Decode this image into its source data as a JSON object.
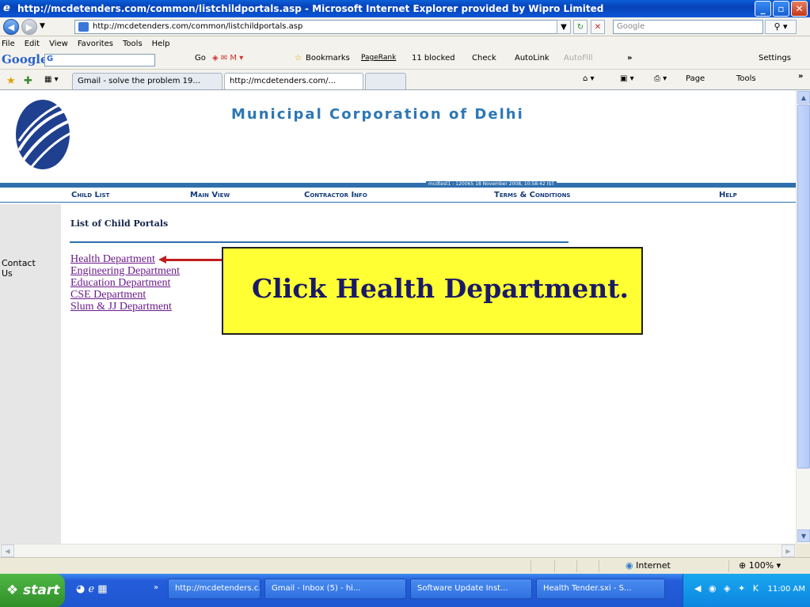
{
  "window": {
    "title": "http://mcdetenders.com/common/listchildportals.asp - Microsoft Internet Explorer provided by Wipro Limited"
  },
  "addressbar": {
    "url": "http://mcdetenders.com/common/listchildportals.asp",
    "search_placeholder": "Google"
  },
  "menubar": {
    "items": [
      "File",
      "Edit",
      "View",
      "Favorites",
      "Tools",
      "Help"
    ]
  },
  "google_toolbar": {
    "logo": "Google",
    "search_value": "G",
    "go": "Go",
    "bookmarks": "Bookmarks",
    "pagerank": "PageRank",
    "blocked": "11 blocked",
    "check": "Check",
    "autolink": "AutoLink",
    "autofill": "AutoFill",
    "more": "»",
    "settings": "Settings"
  },
  "tabs": [
    {
      "label": "Gmail - solve the problem 19..."
    },
    {
      "label": "http://mcdetenders.com/..."
    }
  ],
  "command_bar": {
    "page": "Page",
    "tools": "Tools",
    "more": "»"
  },
  "page": {
    "site_title": "Municipal Corporation of Delhi",
    "user_info": "mcdtest1 - 120065    18 November 2008,  10:58:42  IST",
    "nav": [
      "Child List",
      "Main View",
      "Contractor Info",
      "Terms & Conditions",
      "Help"
    ],
    "contact": "Contact Us",
    "list_title": "List of Child Portals",
    "portals": [
      "Health Department",
      "Engineering Department",
      "Education Department",
      "CSE Department",
      "Slum & JJ Department"
    ],
    "callout": "Click Health Department."
  },
  "statusbar": {
    "zone": "Internet",
    "zoom": "100%"
  },
  "taskbar": {
    "start": "start",
    "items": [
      "http://mcdetenders.c...",
      "Gmail - Inbox (5) - hi...",
      "Software Update Inst...",
      "Health Tender.sxi - S..."
    ],
    "clock": "11:00 AM"
  },
  "colors": {
    "accent": "#2f6fad",
    "callout_bg": "#ffff33",
    "arrow": "#c01d1d",
    "link": "#1a1ad8"
  }
}
